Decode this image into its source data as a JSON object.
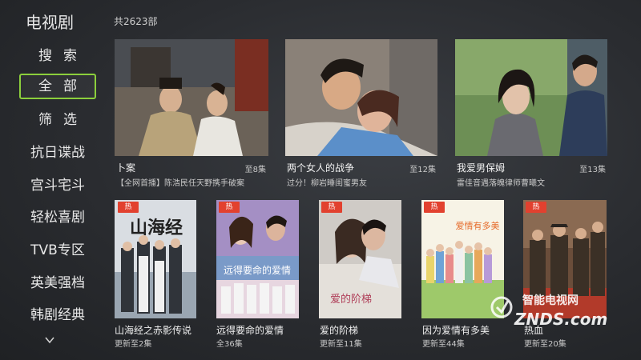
{
  "app": {
    "title": "电视剧",
    "total": "共2623部"
  },
  "sidebar": {
    "items": [
      {
        "label": "搜索"
      },
      {
        "label": "全部"
      },
      {
        "label": "筛选"
      },
      {
        "label": "抗日谍战"
      },
      {
        "label": "宫斗宅斗"
      },
      {
        "label": "轻松喜剧"
      },
      {
        "label": "TVB专区"
      },
      {
        "label": "英美强档"
      },
      {
        "label": "韩剧经典"
      }
    ],
    "down_icon": "chevron-down-icon"
  },
  "row1": [
    {
      "title": "卜案",
      "episodes": "至8集",
      "subtitle": "【全网首播】陈浩民任天野携手破案"
    },
    {
      "title": "两个女人的战争",
      "episodes": "至12集",
      "subtitle": "过分！柳岩睡闺蜜男友"
    },
    {
      "title": "我爱男保姆",
      "episodes": "至13集",
      "subtitle": "雷佳音遇落魄律师曹曦文"
    }
  ],
  "row2": [
    {
      "title": "山海经之赤影传说",
      "status": "更新至2集",
      "badge": "热",
      "poster_text": "山海经"
    },
    {
      "title": "远得要命的爱情",
      "status": "全36集",
      "badge": "热",
      "poster_text": "远得要命的爱情"
    },
    {
      "title": "爱的阶梯",
      "status": "更新至11集",
      "badge": "热",
      "poster_text": "爱的阶梯"
    },
    {
      "title": "因为爱情有多美",
      "status": "更新至44集",
      "badge": "热",
      "poster_text": "爱情有多美"
    },
    {
      "title": "热血",
      "status": "更新至20集",
      "badge": "热"
    }
  ],
  "watermark": {
    "top": "智能电视网",
    "bottom": "ZNDS.com"
  },
  "colors": {
    "active_border": "#8ccf3c",
    "hot_badge": "#e2412f"
  }
}
